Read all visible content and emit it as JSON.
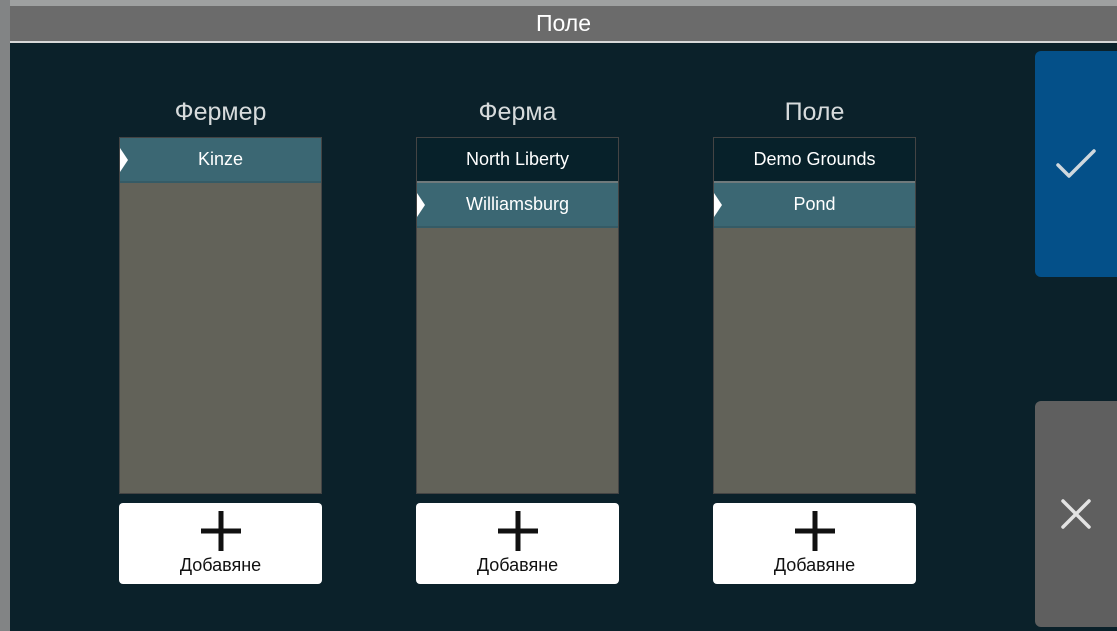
{
  "title": "Поле",
  "colors": {
    "background": "#0b212a",
    "list_bg": "#626259",
    "item_bg": "#07212a",
    "selected_bg": "#3b6773",
    "confirm": "#045089",
    "cancel": "#5f5f5f"
  },
  "columns": [
    {
      "header": "Фермер",
      "items": [
        {
          "label": "Kinze",
          "selected": true
        }
      ],
      "add_label": "Добавяне"
    },
    {
      "header": "Ферма",
      "items": [
        {
          "label": "North Liberty",
          "selected": false
        },
        {
          "label": "Williamsburg",
          "selected": true
        }
      ],
      "add_label": "Добавяне"
    },
    {
      "header": "Поле",
      "items": [
        {
          "label": "Demo Grounds",
          "selected": false
        },
        {
          "label": "Pond",
          "selected": true
        }
      ],
      "add_label": "Добавяне"
    }
  ],
  "actions": {
    "confirm_icon": "check-icon",
    "cancel_icon": "close-icon"
  }
}
